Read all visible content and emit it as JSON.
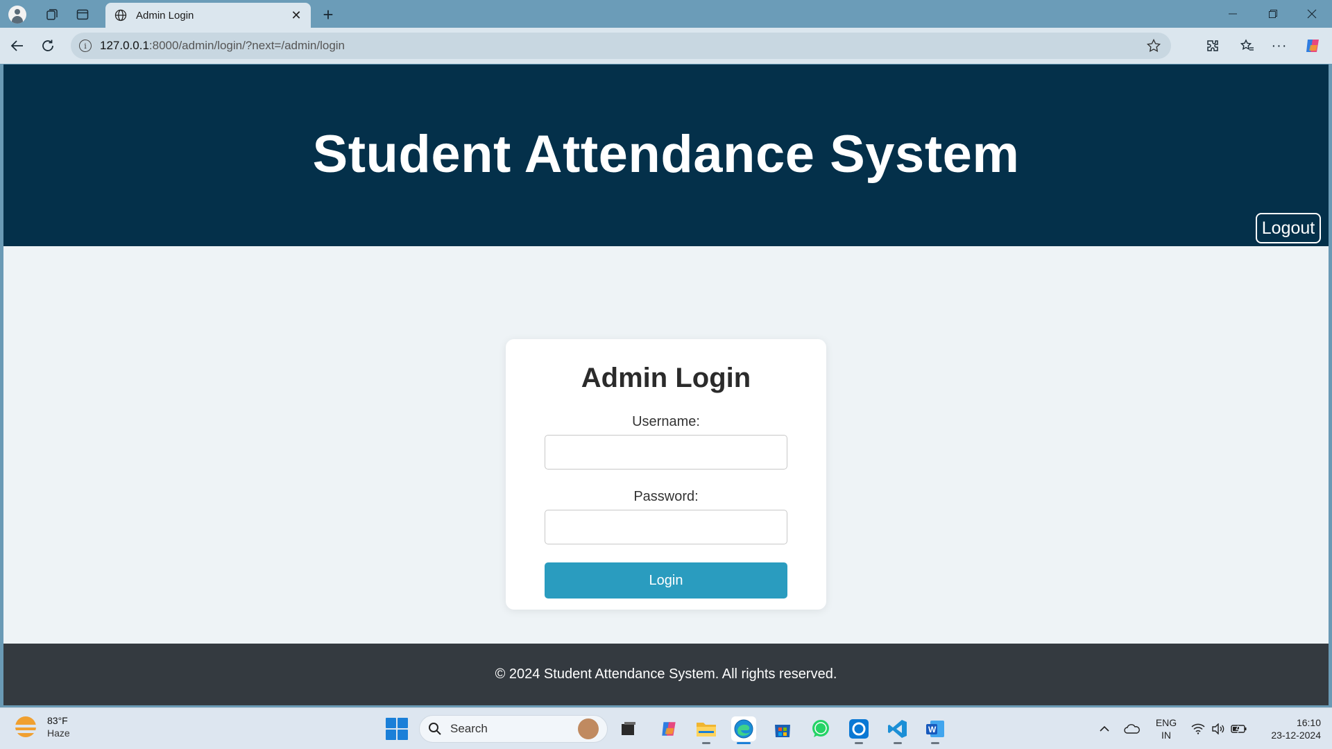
{
  "browser": {
    "tab_title": "Admin Login",
    "url_host": "127.0.0.1",
    "url_rest": ":8000/admin/login/?next=/admin/login"
  },
  "header": {
    "title": "Student Attendance System",
    "logout_label": "Logout"
  },
  "login_form": {
    "title": "Admin Login",
    "username_label": "Username:",
    "username_value": "",
    "password_label": "Password:",
    "password_value": "",
    "submit_label": "Login"
  },
  "footer": {
    "text": "© 2024 Student Attendance System. All rights reserved."
  },
  "taskbar": {
    "weather_temp": "83°F",
    "weather_condition": "Haze",
    "search_placeholder": "Search",
    "lang_line1": "ENG",
    "lang_line2": "IN",
    "time": "16:10",
    "date": "23-12-2024",
    "pinned_apps": [
      "task-view",
      "copilot",
      "file-explorer",
      "edge",
      "microsoft-store",
      "whatsapp",
      "cortana",
      "vscode",
      "word"
    ]
  },
  "colors": {
    "header_bg": "#04304a",
    "page_bg": "#eef3f6",
    "login_button": "#2a9cbf",
    "footer_bg": "#343a40"
  }
}
